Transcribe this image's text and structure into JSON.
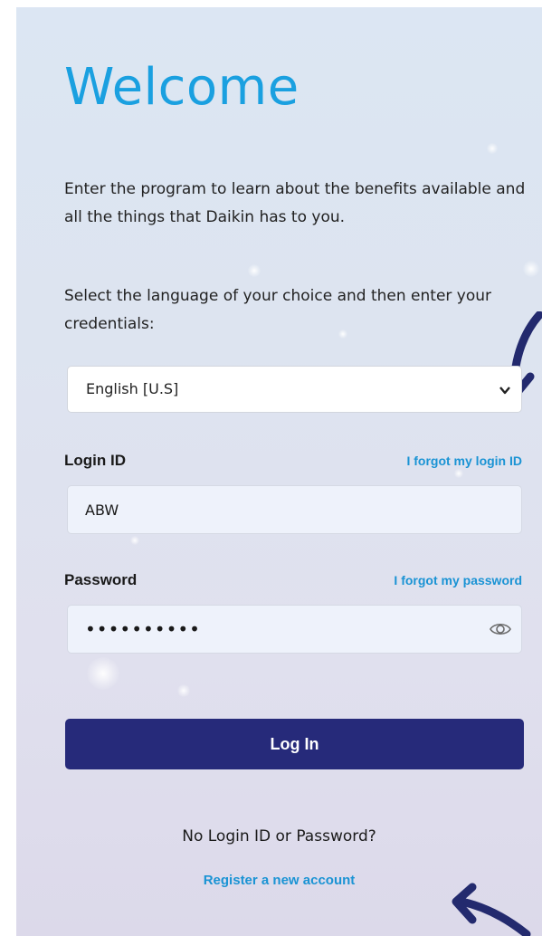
{
  "header": {
    "title": "Welcome"
  },
  "intro": {
    "paragraph1": "Enter the program to learn about the benefits available and all the things that Daikin has to you.",
    "paragraph2": "Select the language of your choice and then enter your credentials:"
  },
  "language_select": {
    "selected": "English [U.S]",
    "icon": "chevron-down-icon"
  },
  "login_id": {
    "label": "Login ID",
    "forgot_link": "I forgot my login ID",
    "value": "ABW"
  },
  "password": {
    "label": "Password",
    "forgot_link": "I forgot my password",
    "value": "••••••••••",
    "toggle_icon": "eye-icon"
  },
  "actions": {
    "login_label": "Log In"
  },
  "footer": {
    "no_login_text": "No Login ID or Password?",
    "register_link": "Register a new account"
  },
  "colors": {
    "title": "#1aa0e0",
    "link": "#1a93d4",
    "button": "#262a7a",
    "annotation_arrow": "#232a6e"
  }
}
